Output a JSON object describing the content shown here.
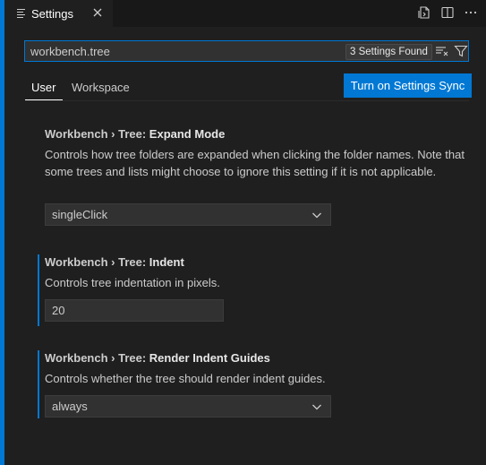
{
  "tab": {
    "title": "Settings",
    "close_icon": "close-icon"
  },
  "search": {
    "value": "workbench.tree",
    "results_badge": "3 Settings Found"
  },
  "scopes": {
    "user": "User",
    "workspace": "Workspace",
    "active": "User"
  },
  "sync_button": "Turn on Settings Sync",
  "settings": [
    {
      "category": "Workbench › Tree: ",
      "name": "Expand Mode",
      "description": "Controls how tree folders are expanded when clicking the folder names. Note that some trees and lists might choose to ignore this setting if it is not applicable.",
      "value": "singleClick",
      "control": "select",
      "modified": false
    },
    {
      "category": "Workbench › Tree: ",
      "name": "Indent",
      "description": "Controls tree indentation in pixels.",
      "value": "20",
      "control": "number",
      "modified": true
    },
    {
      "category": "Workbench › Tree: ",
      "name": "Render Indent Guides",
      "description": "Controls whether the tree should render indent guides.",
      "value": "always",
      "control": "select",
      "modified": true
    }
  ],
  "colors": {
    "accent": "#0078d4",
    "background": "#1f1f1f",
    "input_bg": "#313131"
  }
}
